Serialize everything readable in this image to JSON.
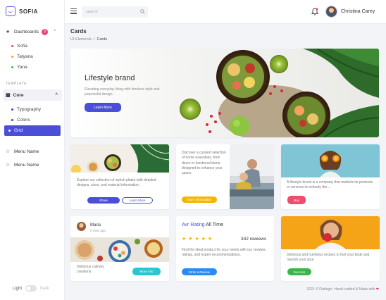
{
  "app": {
    "name": "SOFIA"
  },
  "sidebar": {
    "dashboards": {
      "label": "Dashboards",
      "badge": "3"
    },
    "sub_items": [
      {
        "label": "Sofia",
        "color": "#e8467c"
      },
      {
        "label": "Tatyana",
        "color": "#f0a030"
      },
      {
        "label": "Yana",
        "color": "#3ab54a"
      }
    ],
    "section_label": "TEMPLATE",
    "core": {
      "label": "Core"
    },
    "core_items": [
      {
        "label": "Typography",
        "color": "#3b3fc0"
      },
      {
        "label": "Colors",
        "color": "#3b3fc0"
      },
      {
        "label": "Grid",
        "color": "#ffffff"
      }
    ],
    "menu_items": [
      {
        "label": "Menu Name"
      },
      {
        "label": "Menu Name"
      }
    ],
    "theme": {
      "light": "Light",
      "dark": "Dark"
    }
  },
  "topbar": {
    "search_placeholder": "search",
    "user_name": "Christina Carey"
  },
  "page": {
    "title": "Cards",
    "breadcrumb": [
      "UI Elements",
      "Cards"
    ]
  },
  "hero": {
    "title": "Lifestyle brand",
    "description": "Elevating everyday living with timeless style and purposeful design.",
    "button": "Learn More"
  },
  "cards": {
    "plates": {
      "text": "Explore our collection of stylish plates with detailed designs, sizes, and material information.",
      "share": "Share",
      "learn_more": "Learn More"
    },
    "home": {
      "text": "Discover a curated selection of home essentials, from decor to functional items, designed to enhance your space.",
      "button": "More Information"
    },
    "lifestyle": {
      "text": "A lifestyle brand is a company that markets its products or services to embody the...",
      "button": "Buy"
    },
    "maria": {
      "name": "Maria",
      "time": "5 mins ago",
      "text": "Delicious culinary creations",
      "button": "More Info"
    },
    "rating": {
      "title_accent": "Avr Rating",
      "title_rest": " All Time",
      "stars": "★ ★ ★ ★ ★",
      "reviews": "342 rewiews",
      "text": "Find the ideal product for your needs with our reviews, ratings, and expert recommendations.",
      "button": "Write a Review"
    },
    "nutrition": {
      "text": "Delicious and nutritious recipes to fuel your body and nourish your soul.",
      "button": "Success"
    }
  },
  "footer": {
    "text": "2021 © Flatlogic. Hand-crafted & Made with",
    "heart": "❤"
  },
  "colors": {
    "primary": "#4b4fd8",
    "yellow": "#f2b705",
    "pink": "#ef4d6b",
    "green": "#3ab54a",
    "cyan": "#2ec5d3",
    "blue": "#2a8cf0"
  }
}
